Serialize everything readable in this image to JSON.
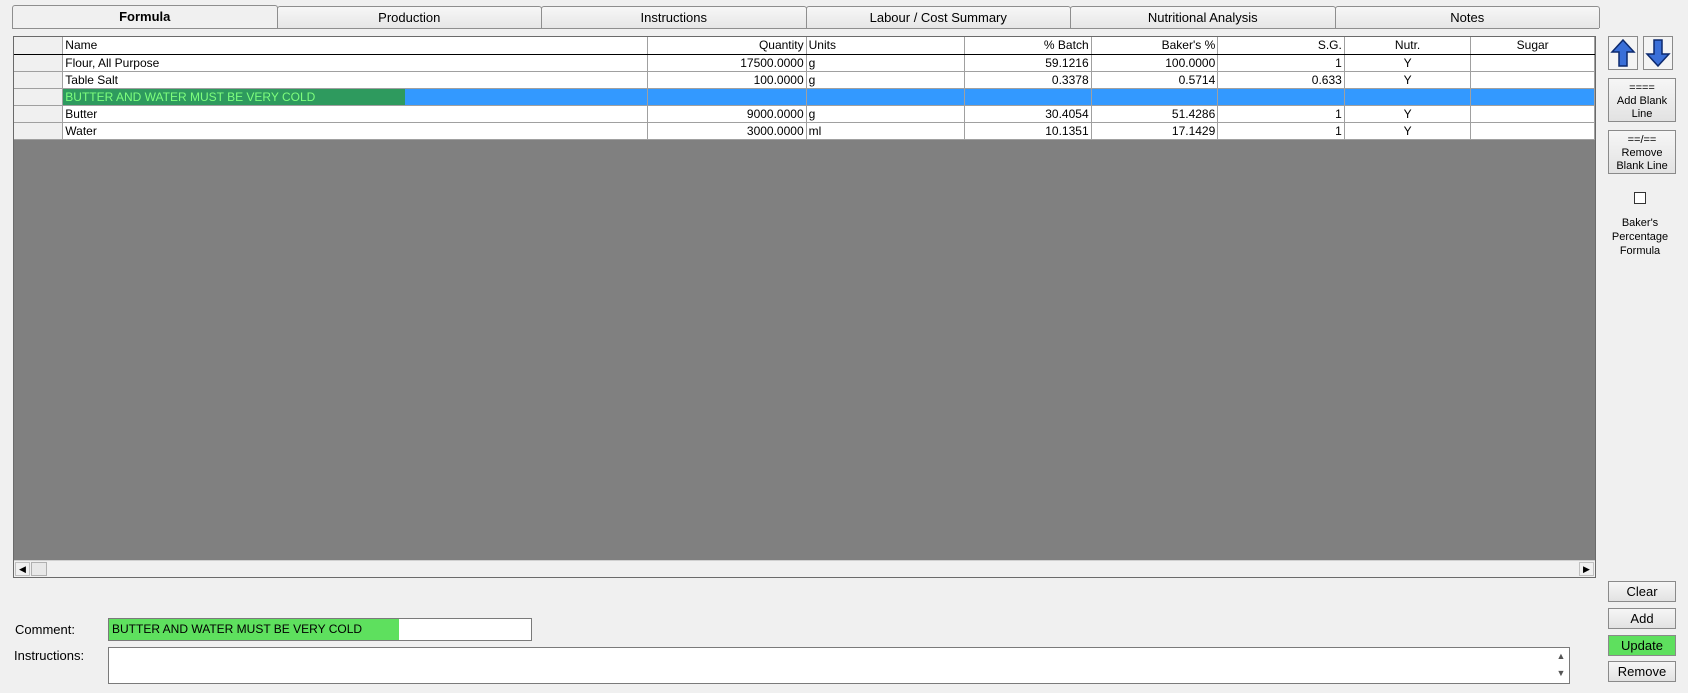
{
  "tabs": [
    "Formula",
    "Production",
    "Instructions",
    "Labour / Cost Summary",
    "Nutritional Analysis",
    "Notes"
  ],
  "columns": {
    "name": "Name",
    "quantity": "Quantity",
    "units": "Units",
    "batch": "% Batch",
    "bakers": "Baker's %",
    "sg": "S.G.",
    "nutr": "Nutr.",
    "sugar": "Sugar"
  },
  "rows": [
    {
      "name": "Flour, All Purpose",
      "quantity": "17500.0000",
      "units": "g",
      "batch": "59.1216",
      "bakers": "100.0000",
      "sg": "1",
      "nutr": "Y",
      "sugar": ""
    },
    {
      "name": "Table Salt",
      "quantity": "100.0000",
      "units": "g",
      "batch": "0.3378",
      "bakers": "0.5714",
      "sg": "0.633",
      "nutr": "Y",
      "sugar": ""
    },
    {
      "name": "BUTTER AND WATER MUST BE VERY COLD",
      "comment": true
    },
    {
      "name": "Butter",
      "quantity": "9000.0000",
      "units": "g",
      "batch": "30.4054",
      "bakers": "51.4286",
      "sg": "1",
      "nutr": "Y",
      "sugar": ""
    },
    {
      "name": "Water",
      "quantity": "3000.0000",
      "units": "ml",
      "batch": "10.1351",
      "bakers": "17.1429",
      "sg": "1",
      "nutr": "Y",
      "sugar": ""
    }
  ],
  "side": {
    "add_blank_icon": "====",
    "add_blank_label": "Add Blank Line",
    "remove_blank_icon": "==/==",
    "remove_blank_label": "Remove Blank Line",
    "bakers_checkbox_label": "Baker's Percentage Formula",
    "bakers_checked": false
  },
  "actions": {
    "clear": "Clear",
    "add": "Add",
    "update": "Update",
    "remove": "Remove"
  },
  "fields": {
    "comment_label": "Comment:",
    "comment_value": "BUTTER AND WATER MUST BE VERY COLD",
    "instructions_label": "Instructions:",
    "instructions_value": ""
  },
  "colors": {
    "selection": "#3399ff",
    "comment_fill": "#2e9a5e",
    "comment_text": "#7dff7d",
    "update_green": "#5ee05e",
    "grid_bg": "#808080"
  }
}
